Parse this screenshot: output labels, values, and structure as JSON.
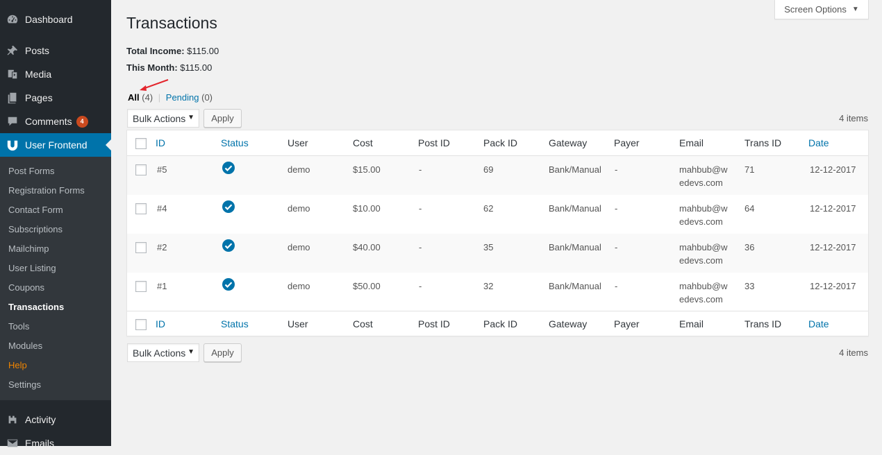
{
  "sidebar": {
    "top_items": [
      {
        "label": "Dashboard",
        "icon": "dashboard-icon"
      },
      {
        "label": "Posts",
        "icon": "pin-icon"
      },
      {
        "label": "Media",
        "icon": "media-icon"
      },
      {
        "label": "Pages",
        "icon": "pages-icon"
      },
      {
        "label": "Comments",
        "icon": "comment-icon",
        "badge": "4"
      },
      {
        "label": "User Frontend",
        "icon": "user-frontend-icon"
      },
      {
        "label": "Activity",
        "icon": "activity-icon"
      },
      {
        "label": "Emails",
        "icon": "email-icon"
      }
    ],
    "submenu": [
      "Post Forms",
      "Registration Forms",
      "Contact Form",
      "Subscriptions",
      "Mailchimp",
      "User Listing",
      "Coupons",
      "Transactions",
      "Tools",
      "Modules",
      "Help",
      "Settings"
    ],
    "active_submenu": "Transactions"
  },
  "screen_options": "Screen Options",
  "page": {
    "title": "Transactions",
    "total_income_label": "Total Income:",
    "total_income_value": "$115.00",
    "this_month_label": "This Month:",
    "this_month_value": "$115.00"
  },
  "filters": {
    "all_label": "All",
    "all_count": "(4)",
    "pending_label": "Pending",
    "pending_count": "(0)"
  },
  "actions": {
    "bulk_label": "Bulk Actions",
    "apply_label": "Apply",
    "items_count": "4 items"
  },
  "table": {
    "columns": [
      "ID",
      "Status",
      "User",
      "Cost",
      "Post ID",
      "Pack ID",
      "Gateway",
      "Payer",
      "Email",
      "Trans ID",
      "Date"
    ],
    "rows": [
      {
        "id": "#5",
        "user": "demo",
        "cost": "$15.00",
        "post_id": "-",
        "pack_id": "69",
        "gateway": "Bank/Manual",
        "payer": "-",
        "email": "mahbub@wedevs.com",
        "trans_id": "71",
        "date": "12-12-2017"
      },
      {
        "id": "#4",
        "user": "demo",
        "cost": "$10.00",
        "post_id": "-",
        "pack_id": "62",
        "gateway": "Bank/Manual",
        "payer": "-",
        "email": "mahbub@wedevs.com",
        "trans_id": "64",
        "date": "12-12-2017"
      },
      {
        "id": "#2",
        "user": "demo",
        "cost": "$40.00",
        "post_id": "-",
        "pack_id": "35",
        "gateway": "Bank/Manual",
        "payer": "-",
        "email": "mahbub@wedevs.com",
        "trans_id": "36",
        "date": "12-12-2017"
      },
      {
        "id": "#1",
        "user": "demo",
        "cost": "$50.00",
        "post_id": "-",
        "pack_id": "32",
        "gateway": "Bank/Manual",
        "payer": "-",
        "email": "mahbub@wedevs.com",
        "trans_id": "33",
        "date": "12-12-2017"
      }
    ]
  },
  "colors": {
    "sidebar_bg": "#23282d",
    "submenu_bg": "#32373c",
    "accent": "#0073aa",
    "badge": "#ca4a1f",
    "help": "#f18500"
  }
}
